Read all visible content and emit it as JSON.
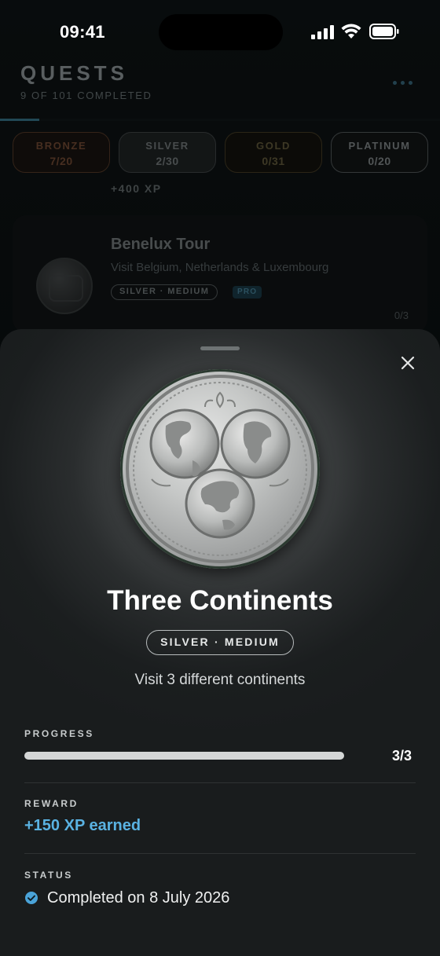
{
  "status_bar": {
    "time": "09:41"
  },
  "header": {
    "title": "QUESTS",
    "subtitle": "9 OF 101 COMPLETED"
  },
  "tiers": [
    {
      "name": "BRONZE",
      "value": "7/20"
    },
    {
      "name": "SILVER",
      "value": "2/30"
    },
    {
      "name": "GOLD",
      "value": "0/31"
    },
    {
      "name": "PLATINUM",
      "value": "0/20"
    }
  ],
  "background_list": {
    "xp_label": "+400 XP",
    "quest": {
      "name": "Benelux Tour",
      "description": "Visit Belgium, Netherlands & Luxembourg",
      "tier": "SILVER · MEDIUM",
      "badge": "PRO",
      "count": "0/3"
    }
  },
  "sheet": {
    "title": "Three Continents",
    "tier": "SILVER · MEDIUM",
    "description": "Visit 3 different continents",
    "progress_label": "PROGRESS",
    "progress_value": 1.0,
    "progress_text": "3/3",
    "reward_label": "REWARD",
    "reward_text": "+150 XP earned",
    "status_label": "STATUS",
    "status_text": "Completed on 8 July 2026"
  },
  "colors": {
    "accent_blue": "#5ab2e2",
    "check_blue": "#4aa3d8",
    "sheet_bg": "#1b1e1f"
  }
}
